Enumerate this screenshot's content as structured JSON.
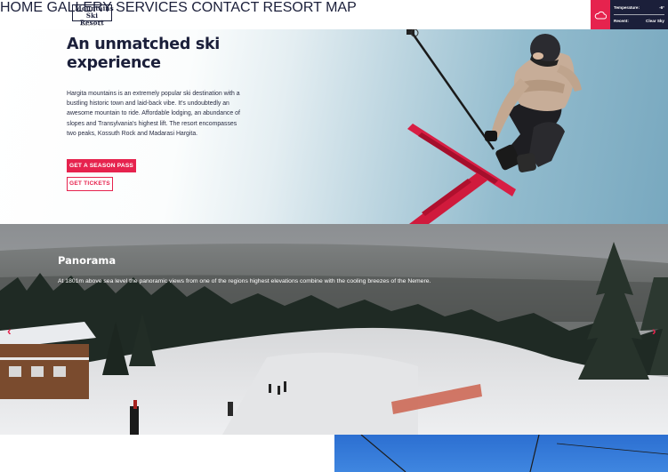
{
  "brand": {
    "logo_line1": "Mountains",
    "logo_line2": "Ski Resort",
    "logo_sub": "HARGITA, RO"
  },
  "nav": {
    "items": [
      "HOME",
      "GALLERY",
      "SERVICES",
      "CONTACT",
      "RESORT MAP"
    ]
  },
  "weather": {
    "icon": "cloud-icon",
    "temperature_label": "Temperature:",
    "temperature_value": "-6°",
    "recent_label": "Recent:",
    "recent_value": "Clear Sky"
  },
  "hero": {
    "title": "An unmatched ski experience",
    "text": "Hargita mountains is an extremely popular ski destination with a bustling historic town and laid-back vibe. It's undoubtedly an awesome mountain to ride. Affordable lodging, an abundance of slopes and Transylvania's highest lift. The resort encompasses two peaks, Kossuth Rock and Madarasi Hargita.",
    "primary_button": "GET A SEASON PASS",
    "secondary_button": "GET TICKETS"
  },
  "panorama": {
    "title": "Panorama",
    "text": "At 1801m above sea level the panoramic views from one of the regions highest elevations combine with the cooling breezes of the Nemere.",
    "prev_icon": "chevron-left-icon",
    "next_icon": "chevron-right-icon"
  },
  "colors": {
    "accent": "#e6234e",
    "navy": "#1b1f3a"
  }
}
